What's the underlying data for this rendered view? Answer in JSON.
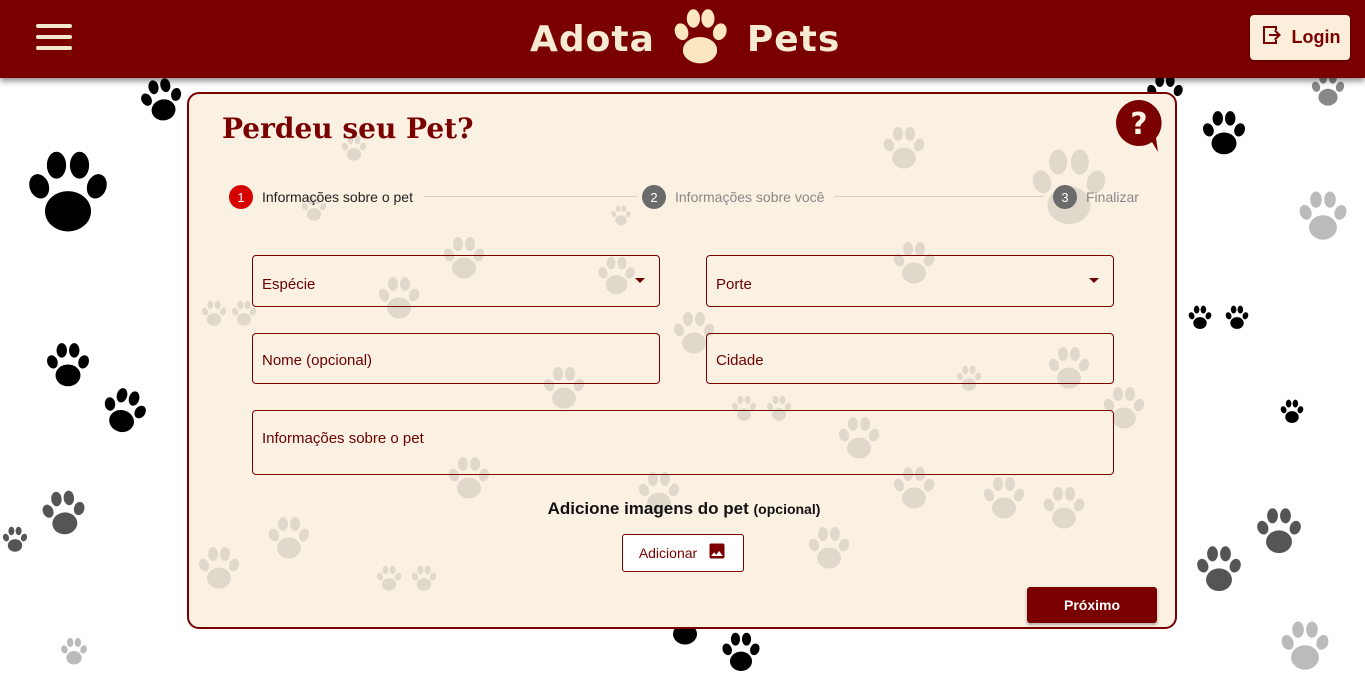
{
  "header": {
    "brand_left": "Adota",
    "brand_right": "Pets",
    "login_label": "Login"
  },
  "page": {
    "title": "Perdeu seu Pet?"
  },
  "stepper": {
    "steps": [
      {
        "number": "1",
        "label": "Informações sobre o pet",
        "state": "active"
      },
      {
        "number": "2",
        "label": "Informações sobre você",
        "state": "inactive"
      },
      {
        "number": "3",
        "label": "Finalizar",
        "state": "inactive"
      }
    ]
  },
  "form": {
    "especie_label": "Espécie",
    "porte_label": "Porte",
    "nome_label": "Nome (opcional)",
    "cidade_label": "Cidade",
    "info_label": "Informações sobre o pet"
  },
  "images": {
    "title": "Adicione imagens do pet",
    "optional": "(opcional)",
    "add_label": "Adicionar"
  },
  "actions": {
    "next_label": "Próximo"
  },
  "colors": {
    "brand": "#7a0000",
    "card_bg": "#fbf1e3",
    "step_active": "#d60000",
    "step_inactive": "#666666"
  },
  "icons": [
    "menu-icon",
    "paw-logo-icon",
    "login-icon",
    "help-icon",
    "image-icon",
    "dropdown-arrow-icon"
  ]
}
